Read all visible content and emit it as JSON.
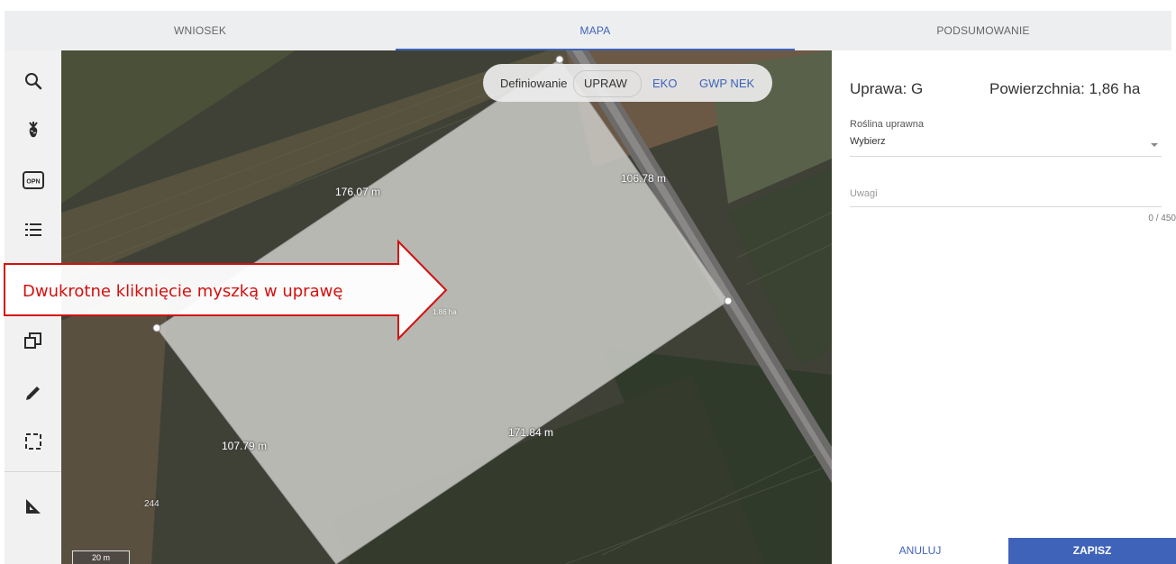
{
  "tabs": [
    {
      "label": "WNIOSEK",
      "active": false
    },
    {
      "label": "MAPA",
      "active": true
    },
    {
      "label": "PODSUMOWANIE",
      "active": false
    }
  ],
  "toolbar": {
    "opn_label": "OPN",
    "tools": [
      "search-icon",
      "crop-icon",
      "opn-icon",
      "list-icon",
      "copy-icon",
      "pencil-icon",
      "select-area-icon",
      "measure-icon"
    ]
  },
  "definition_bar": {
    "label": "Definiowanie",
    "options": [
      "UPRAW",
      "EKO",
      "GWP NEK"
    ],
    "selected": "UPRAW"
  },
  "map": {
    "segments": [
      "176.07 m",
      "106.78 m",
      "107.79 m",
      "171.84 m"
    ],
    "area_label": "1.86 ha",
    "parcel_number": "244",
    "scale": "20 m"
  },
  "panel": {
    "title": "Uprawa: G",
    "area": "Powierzchnia: 1,86 ha",
    "crop_label": "Roślina uprawna",
    "crop_value": "Wybierz",
    "notes_placeholder": "Uwagi",
    "notes_counter": "0 / 450"
  },
  "buttons": {
    "cancel": "ANULUJ",
    "save": "ZAPISZ"
  },
  "annotation": {
    "text": "Dwukrotne kliknięcie myszką w uprawę",
    "color": "#d41010"
  },
  "colors": {
    "accent": "#3f63b8",
    "toolbar_bg": "#f1f1f2",
    "tab_bg": "#eceef0"
  }
}
